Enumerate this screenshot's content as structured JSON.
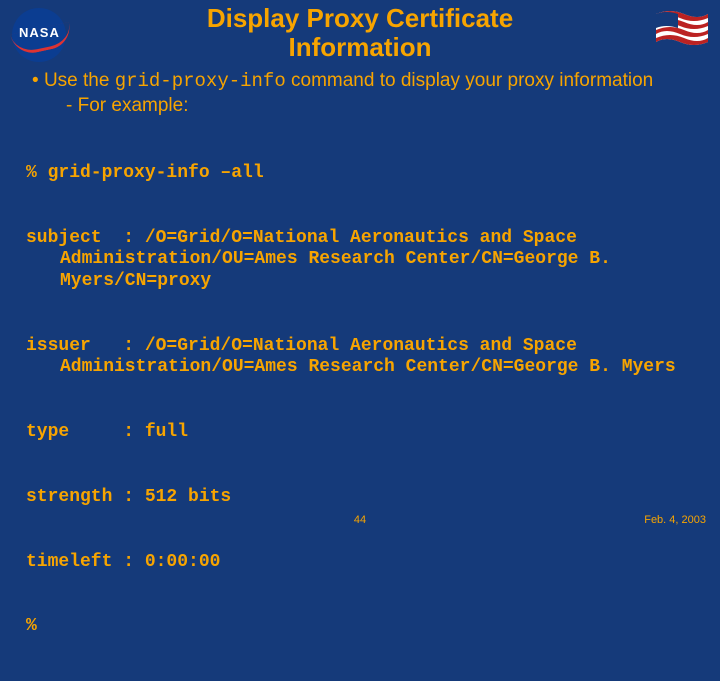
{
  "title_l1": "Display Proxy Certificate",
  "title_l2": "Information",
  "bullet_pre": "Use the ",
  "bullet_cmd": "grid-proxy-info",
  "bullet_post": " command to display your proxy information",
  "bullet_sub": "- For example:",
  "code": {
    "l1": "% grid-proxy-info –all",
    "l2": "subject  : /O=Grid/O=National Aeronautics and Space Administration/OU=Ames Research Center/CN=George B. Myers/CN=proxy",
    "l3": "issuer   : /O=Grid/O=National Aeronautics and Space Administration/OU=Ames Research Center/CN=George B. Myers",
    "l4": "type     : full",
    "l5": "strength : 512 bits",
    "l6": "timeleft : 0:00:00",
    "l7": "%"
  },
  "page_number": "44",
  "date": "Feb. 4, 2003"
}
